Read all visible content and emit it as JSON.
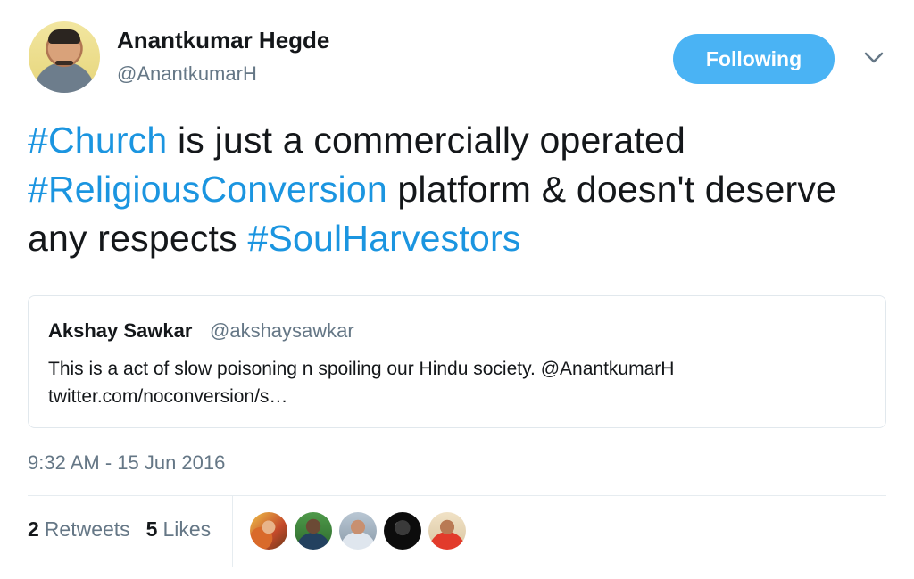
{
  "author": {
    "name": "Anantkumar Hegde",
    "handle": "@AnantkumarH",
    "avatar_icon": "profile-photo"
  },
  "header": {
    "follow_label": "Following",
    "menu_icon": "chevron-down-icon"
  },
  "tweet": {
    "segments": [
      {
        "text": "#Church",
        "tag": true
      },
      {
        "text": " is just a commercially operated ",
        "tag": false
      },
      {
        "text": "#ReligiousConversion",
        "tag": true
      },
      {
        "text": " platform & doesn't deserve any respects ",
        "tag": false
      },
      {
        "text": "#SoulHarvestors",
        "tag": true
      }
    ]
  },
  "quote": {
    "name": "Akshay Sawkar",
    "handle": "@akshaysawkar",
    "text_line1": "This is a act of slow poisoning n spoiling our Hindu society.  @AnantkumarH",
    "text_line2": "twitter.com/noconversion/s…"
  },
  "timestamp": "9:32 AM - 15 Jun 2016",
  "stats": {
    "retweets_count": "2",
    "retweets_label": "Retweets",
    "likes_count": "5",
    "likes_label": "Likes"
  },
  "likers": [
    "liker-avatar-1",
    "liker-avatar-2",
    "liker-avatar-3",
    "liker-avatar-4",
    "liker-avatar-5"
  ],
  "colors": {
    "hashtag": "#1b95e0",
    "button": "#4ab3f4",
    "secondary_text": "#657786",
    "divider": "#e6ecf0"
  }
}
